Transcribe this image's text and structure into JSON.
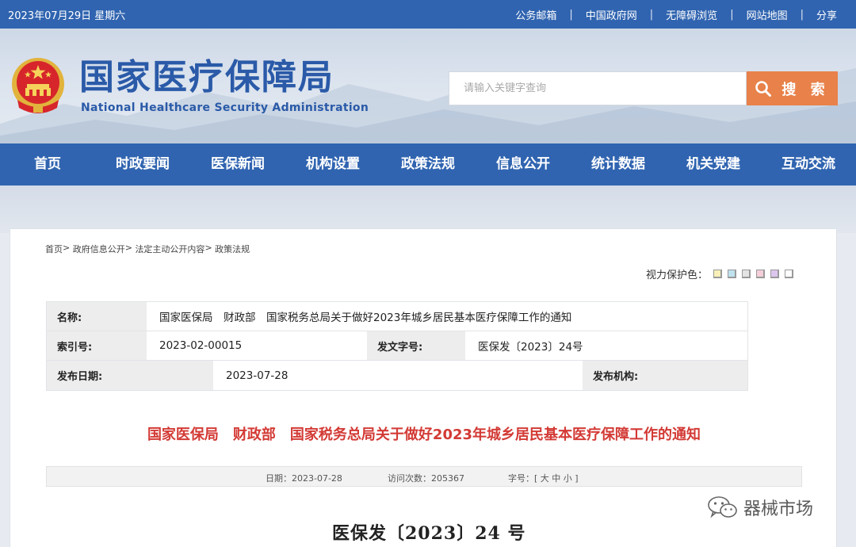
{
  "topbar": {
    "date": "2023年07月29日  星期六",
    "links": [
      "公务邮箱",
      "中国政府网",
      "无障碍浏览",
      "网站地图",
      "分享"
    ]
  },
  "header": {
    "logo_cn": "国家医疗保障局",
    "logo_en": "National Healthcare Security Administration",
    "search_placeholder": "请输入关键字查询",
    "search_button": "搜 索",
    "brand_color": "#3064b0",
    "accent_color": "#e8814a"
  },
  "nav": [
    "首页",
    "时政要闻",
    "医保新闻",
    "机构设置",
    "政策法规",
    "信息公开",
    "统计数据",
    "机关党建",
    "互动交流"
  ],
  "breadcrumb": [
    "首页",
    "政府信息公开",
    "法定主动公开内容",
    "政策法规"
  ],
  "eye_care": {
    "label": "视力保护色：",
    "swatches": [
      "#f8f0b8",
      "#bfe2ee",
      "#e4e4e4",
      "#f4cfd9",
      "#dcc6ee",
      "#ffffff"
    ]
  },
  "meta": {
    "name_label": "名称:",
    "name_value": "国家医保局　财政部　国家税务总局关于做好2023年城乡居民基本医疗保障工作的通知",
    "index_label": "索引号:",
    "index_value": "2023-02-00015",
    "docno_label": "发文字号:",
    "docno_value": "医保发〔2023〕24号",
    "date_label": "发布日期:",
    "date_value": "2023-07-28",
    "org_label": "发布机构:",
    "org_value": ""
  },
  "article": {
    "title": "国家医保局　财政部　国家税务总局关于做好2023年城乡居民基本医疗保障工作的通知",
    "date": "日期：2023-07-28",
    "visits": "访问次数：205367",
    "font_size_label": "字号：[",
    "font_large": "大",
    "font_medium": "中",
    "font_small": "小",
    "font_close": "]",
    "doc_number": "医保发〔2023〕24 号"
  },
  "watermark": "器械市场"
}
